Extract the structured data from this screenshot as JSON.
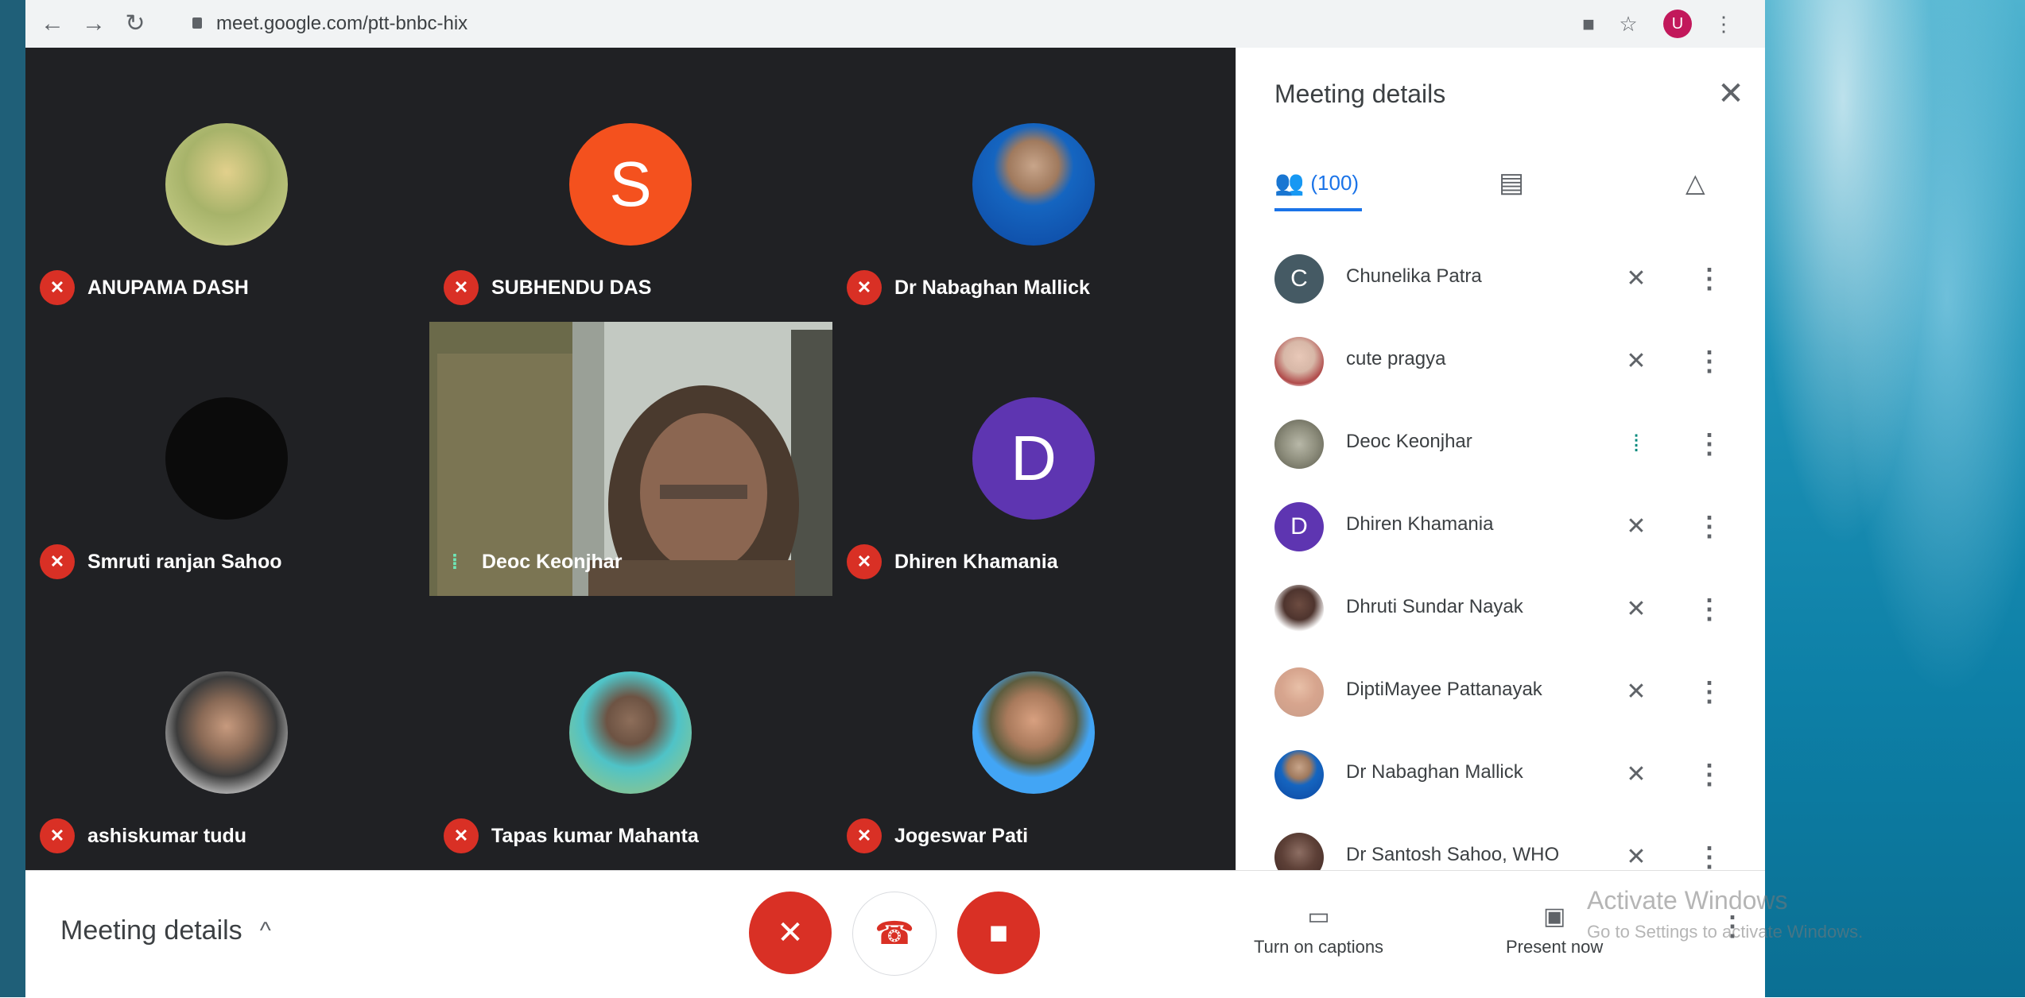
{
  "browser": {
    "url": "meet.google.com/ptt-bnbc-hix",
    "profile_initial": "U"
  },
  "grid": {
    "tiles": [
      {
        "name": "ANUPAMA DASH",
        "muted": true,
        "avatar_type": "photo",
        "avatar_color": "#d9c48a"
      },
      {
        "name": "SUBHENDU DAS",
        "muted": true,
        "avatar_type": "letter",
        "letter": "S",
        "avatar_color": "#f4511e"
      },
      {
        "name": "Dr Nabaghan Mallick",
        "muted": true,
        "avatar_type": "photo",
        "avatar_color": "#1565c0"
      },
      {
        "name": "Smruti ranjan Sahoo",
        "muted": true,
        "avatar_type": "dark",
        "avatar_color": "#0b0b0b"
      },
      {
        "name": "Deoc Keonjhar",
        "muted": false,
        "speaking": true,
        "avatar_type": "video"
      },
      {
        "name": "Dhiren Khamania",
        "muted": true,
        "avatar_type": "letter",
        "letter": "D",
        "avatar_color": "#5e35b1"
      },
      {
        "name": "ashiskumar tudu",
        "muted": true,
        "avatar_type": "photo",
        "avatar_color": "#9e9e9e"
      },
      {
        "name": "Tapas kumar Mahanta",
        "muted": true,
        "avatar_type": "photo",
        "avatar_color": "#4fc3c7"
      },
      {
        "name": "Jogeswar Pati",
        "muted": true,
        "avatar_type": "photo",
        "avatar_color": "#42a5f5"
      }
    ]
  },
  "panel": {
    "title": "Meeting details",
    "people_count": "(100)",
    "participants": [
      {
        "name": "Chunelika Patra",
        "avatar_type": "letter",
        "letter": "C",
        "avatar_color": "#455a64",
        "mic": "off"
      },
      {
        "name": "cute pragya",
        "avatar_type": "photo",
        "avatar_color": "#d7b7a7",
        "mic": "off"
      },
      {
        "name": "Deoc Keonjhar",
        "avatar_type": "photo",
        "avatar_color": "#8d8d7c",
        "mic": "speaking"
      },
      {
        "name": "Dhiren Khamania",
        "avatar_type": "letter",
        "letter": "D",
        "avatar_color": "#5e35b1",
        "mic": "off"
      },
      {
        "name": "Dhruti Sundar Nayak",
        "avatar_type": "photo",
        "avatar_color": "#6d4c41",
        "mic": "off"
      },
      {
        "name": "DiptiMayee Pattanayak",
        "avatar_type": "photo",
        "avatar_color": "#d7a58e",
        "mic": "off"
      },
      {
        "name": "Dr Nabaghan Mallick",
        "avatar_type": "photo",
        "avatar_color": "#1565c0",
        "mic": "off"
      },
      {
        "name": "Dr Santosh Sahoo, WHO",
        "avatar_type": "photo",
        "avatar_color": "#5d4037",
        "mic": "off"
      }
    ]
  },
  "bottom": {
    "meeting_details": "Meeting details",
    "captions_label": "Turn on captions",
    "present_label": "Present now",
    "watermark_title": "Activate Windows",
    "watermark_sub": "Go to Settings to activate Windows."
  }
}
